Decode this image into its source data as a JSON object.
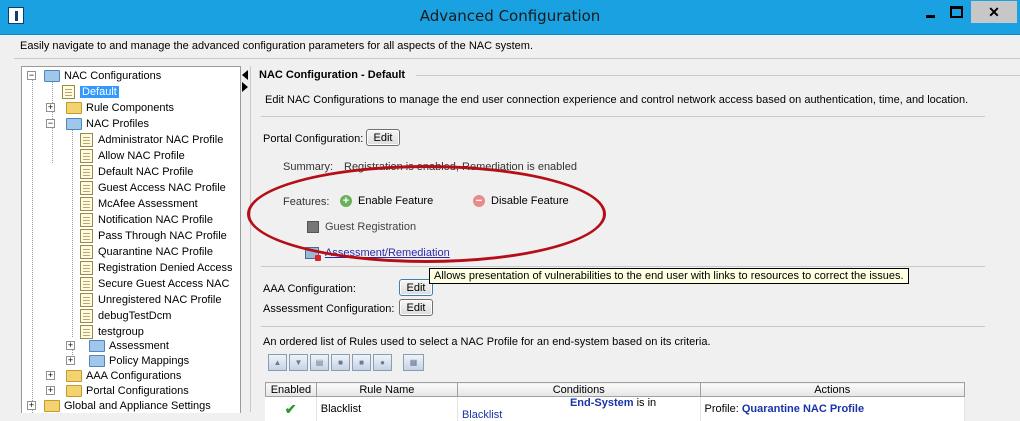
{
  "window": {
    "title": "Advanced Configuration",
    "description": "Easily navigate to and manage the advanced configuration parameters for all aspects of the NAC system."
  },
  "tree": {
    "nac_configurations": "NAC Configurations",
    "default": "Default",
    "rule_components": "Rule Components",
    "nac_profiles": "NAC Profiles",
    "profiles": [
      "Administrator NAC Profile",
      "Allow NAC Profile",
      "Default NAC Profile",
      "Guest Access NAC Profile",
      "McAfee Assessment",
      "Notification NAC Profile",
      "Pass Through NAC Profile",
      "Quarantine NAC Profile",
      "Registration Denied Access",
      "Secure Guest Access NAC",
      "Unregistered NAC Profile",
      "debugTestDcm",
      "testgroup"
    ],
    "assessment": "Assessment",
    "policy_mappings": "Policy Mappings",
    "aaa_configurations": "AAA Configurations",
    "portal_configurations": "Portal Configurations",
    "global_settings": "Global and Appliance Settings"
  },
  "main": {
    "section_title": "NAC Configuration - Default",
    "description": "Edit NAC Configurations to manage the end user connection experience and control network access based on authentication, time, and location.",
    "portal_configuration_label": "Portal Configuration:",
    "edit_label": "Edit",
    "summary_label": "Summary:",
    "summary_text": "Registration is enabled, Remediation is enabled",
    "features_label": "Features:",
    "enable_feature": "Enable Feature",
    "disable_feature": "Disable Feature",
    "guest_registration": "Guest Registration",
    "assessment_remediation": "Assessment/Remediation",
    "tooltip": "Allows presentation of vulnerabilities to the end user with links to resources to correct the issues.",
    "aaa_configuration_label": "AAA Configuration:",
    "assessment_configuration_label": "Assessment Configuration:",
    "rules_description": "An ordered list of Rules used to select a NAC Profile for an end-system based on its criteria."
  },
  "rules_table": {
    "headers": [
      "Enabled",
      "Rule Name",
      "Conditions",
      "Actions"
    ],
    "rows": [
      {
        "enabled": "✔",
        "rule_name": "Blacklist",
        "condition_subject": "End-System",
        "condition_op": "is in",
        "condition_value": "Blacklist",
        "action_label": "Profile:",
        "action_value": "Quarantine NAC Profile"
      }
    ]
  },
  "colors": {
    "titlebar": "#1aa1e1",
    "selection": "#3399ff",
    "highlight_ellipse": "#b50e16",
    "link": "#2a2aa8"
  }
}
